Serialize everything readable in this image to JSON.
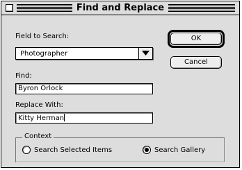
{
  "dialog": {
    "title": "Find and Replace",
    "field_to_search_label": "Field to Search:",
    "field_to_search_value": "Photographer",
    "find_label": "Find:",
    "find_value": "Byron Orlock",
    "replace_label": "Replace With:",
    "replace_value": "Kitty Herman",
    "ok_label": "OK",
    "cancel_label": "Cancel",
    "context": {
      "title": "Context",
      "options": [
        {
          "label": "Search Selected Items",
          "selected": false
        },
        {
          "label": "Search Gallery",
          "selected": true
        }
      ]
    }
  }
}
